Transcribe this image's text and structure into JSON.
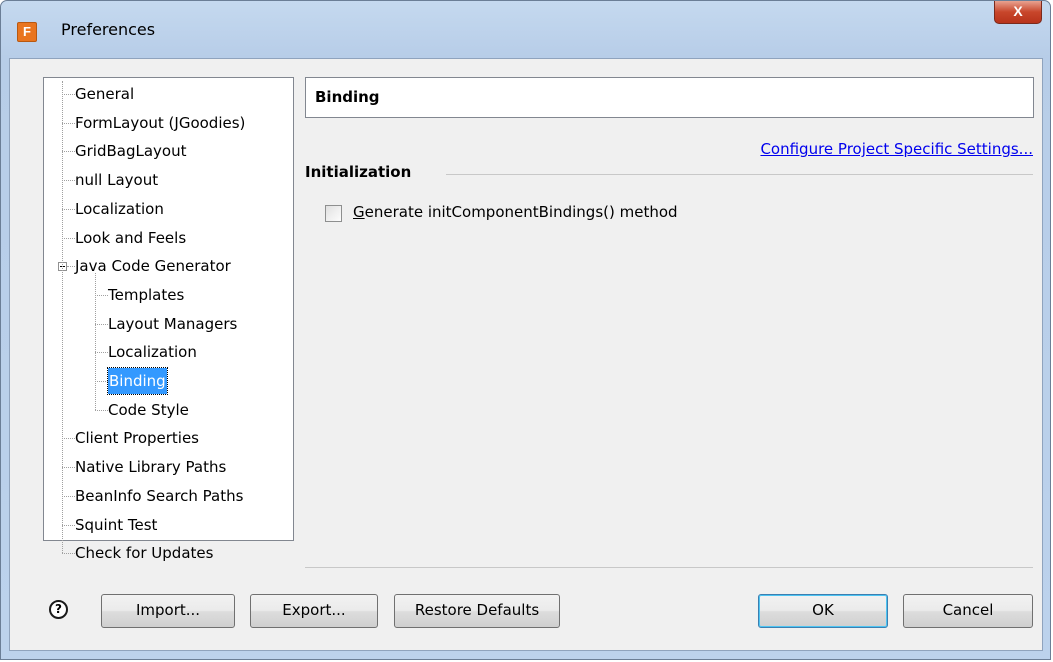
{
  "window": {
    "title": "Preferences",
    "app_icon": "F",
    "close": "X"
  },
  "tree": [
    {
      "label": "General",
      "level": 0
    },
    {
      "label": "FormLayout (JGoodies)",
      "level": 0
    },
    {
      "label": "GridBagLayout",
      "level": 0
    },
    {
      "label": "null Layout",
      "level": 0
    },
    {
      "label": "Localization",
      "level": 0
    },
    {
      "label": "Look and Feels",
      "level": 0
    },
    {
      "label": "Java Code Generator",
      "level": 0,
      "expanded": true
    },
    {
      "label": "Templates",
      "level": 1
    },
    {
      "label": "Layout Managers",
      "level": 1
    },
    {
      "label": "Localization",
      "level": 1
    },
    {
      "label": "Binding",
      "level": 1,
      "selected": true
    },
    {
      "label": "Code Style",
      "level": 1
    },
    {
      "label": "Client Properties",
      "level": 0
    },
    {
      "label": "Native Library Paths",
      "level": 0
    },
    {
      "label": "BeanInfo Search Paths",
      "level": 0
    },
    {
      "label": "Squint Test",
      "level": 0
    },
    {
      "label": "Check for Updates",
      "level": 0
    }
  ],
  "page": {
    "title": "Binding",
    "project_link": "Configure Project Specific Settings...",
    "section": "Initialization",
    "checkbox_label": "Generate initComponentBindings() method",
    "checkbox_checked": false
  },
  "buttons": {
    "help": "?",
    "import": "Import...",
    "export": "Export...",
    "restore": "Restore Defaults",
    "ok": "OK",
    "cancel": "Cancel"
  }
}
